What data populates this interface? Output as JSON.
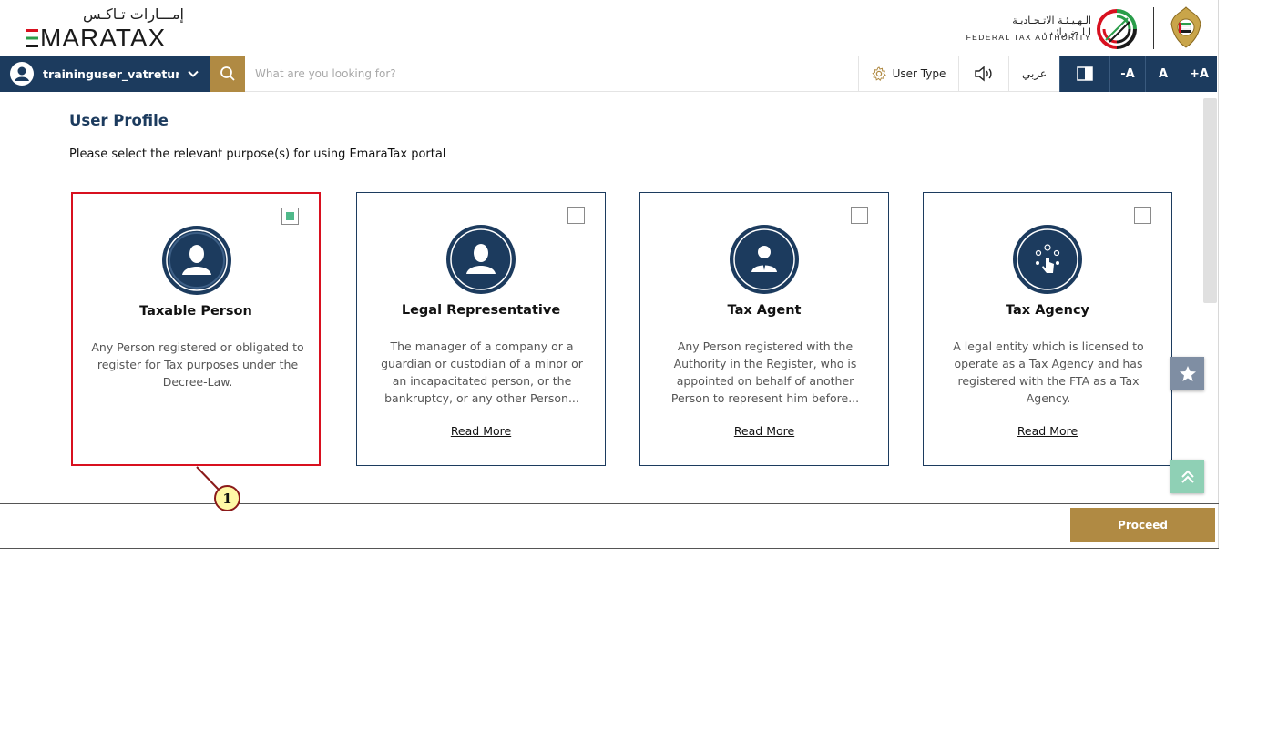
{
  "header": {
    "brand_ar": "إمـــارات تـاكـس",
    "brand_en": "MARATAX",
    "authority_ar": "الـهـيـئـة الاتـحـاديـة لـلـضـرائـب",
    "authority_en": "FEDERAL TAX AUTHORITY"
  },
  "toolbar": {
    "username": "traininguser_vatreturns...",
    "search_placeholder": "What are you looking for?",
    "user_type_label": "User Type",
    "language_label": "عربي",
    "font_decrease": "-A",
    "font_normal": "A",
    "font_increase": "+A"
  },
  "page": {
    "title": "User Profile",
    "instruction": "Please select the relevant purpose(s) for using EmaraTax portal"
  },
  "cards": [
    {
      "title": "Taxable Person",
      "description": "Any Person registered or obligated to register for Tax purposes under the Decree-Law.",
      "selected": true,
      "icon": "person-icon"
    },
    {
      "title": "Legal Representative",
      "description": "The manager of a company or a guardian or custodian of a minor or an incapacitated person, or the bankruptcy, or any other Person...",
      "read_more": "Read More",
      "selected": false,
      "icon": "person-icon"
    },
    {
      "title": "Tax Agent",
      "description": "Any Person registered with the Authority in the Register, who is appointed on behalf of another Person to represent him before...",
      "read_more": "Read More",
      "selected": false,
      "icon": "agent-icon"
    },
    {
      "title": "Tax Agency",
      "description": "A legal entity which is licensed to operate as a Tax Agency and has registered with the FTA as a Tax Agency.",
      "read_more": "Read More",
      "selected": false,
      "icon": "network-touch-icon"
    }
  ],
  "footer": {
    "proceed_label": "Proceed"
  },
  "annotation": {
    "number": "1"
  },
  "colors": {
    "navy": "#1c3b5e",
    "gold": "#b08a43",
    "selected_border": "#d8101f",
    "checkbox_fill": "#4fb98a"
  }
}
